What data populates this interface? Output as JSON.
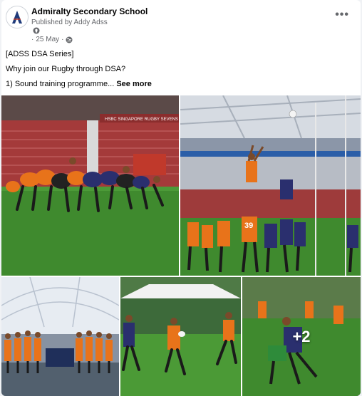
{
  "post": {
    "page_name": "Admiralty Secondary School",
    "published_by": "Published by Addy Adss",
    "date": "25 May",
    "date_separator": "·",
    "more_label": "•••",
    "lines": [
      "[ADSS DSA Series]",
      "Why join our Rugby through DSA?",
      "1) Sound training programme..."
    ],
    "see_more": "See more"
  },
  "photos": {
    "photo1_banner": "HSBC SINGAPORE RUGBY SEVENS",
    "photo2_jersey": "39",
    "extra_count": "+2"
  },
  "colors": {
    "brand_text": "#050505",
    "secondary_text": "#65676b",
    "jersey_orange": "#e8731a",
    "jersey_stripe": "#2a2f6e",
    "pitch_green": "#3f8a2e"
  },
  "icons": [
    "school-crest-icon",
    "location-pin-icon",
    "globe-icon",
    "more-options-icon"
  ]
}
